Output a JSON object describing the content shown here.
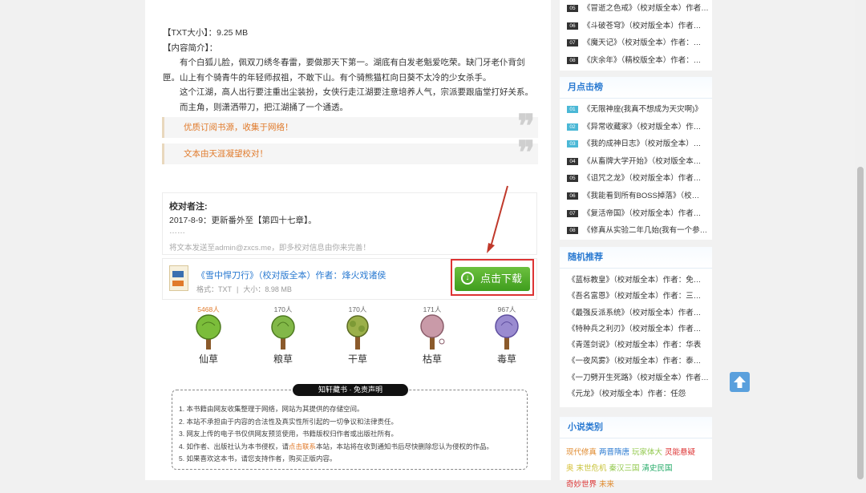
{
  "book": {
    "txt_size_line": "【TXT大小】：9.25 MB",
    "intro_heading": "【内容简介】：",
    "intro": [
      "有个白狐儿脸，佩双刀绣冬春雷，要做那天下第一。湖底有白发老魁爱吃荣。缺门牙老仆背剑匣。山上有个骑青牛的年轻师叔祖，不敢下山。有个骑熊猫杠向日葵不太冷的少女杀手。",
      "这个江湖，高人出行要注重出尘装扮，女侠行走江湖要注意培养人气，宗派要跟庙堂打好关系。",
      "而主角，则潇洒带刀，把江湖捅了一个通透。"
    ]
  },
  "quotes": [
    "优质订阅书源，收集于网络！",
    "文本由天涯凝望校对！"
  ],
  "proof_note": {
    "title": "校对者注:",
    "line": "2017-8-9：更新番外至【第四十七章】。",
    "dots": "……",
    "tip": "将文本发送至admin@zxcs.me，即多校对信息由你来完善！"
  },
  "download": {
    "link_text": "《雪中悍刀行》（校对版全本）作者：烽火戏诸侯",
    "format_label": "格式：TXT",
    "size_label": "大小：8.98 MB",
    "button_label": "点击下载",
    "button_icon": "download-arrow-icon"
  },
  "votes": [
    {
      "label": "仙草",
      "count": "5468人",
      "hot": true,
      "color": "#7bbd3a"
    },
    {
      "label": "粮草",
      "count": "170人",
      "hot": false,
      "color": "#82b848"
    },
    {
      "label": "干草",
      "count": "170人",
      "hot": false,
      "color": "#9bb04a"
    },
    {
      "label": "枯草",
      "count": "171人",
      "hot": false,
      "color": "#c99aa8"
    },
    {
      "label": "毒草",
      "count": "967人",
      "hot": false,
      "color": "#9a8bd0"
    }
  ],
  "notice": {
    "tag": "知轩藏书 · 免责声明",
    "items": [
      {
        "text": "1.  本书籍由网友收集整理于网络，网站为其提供的存储空间。"
      },
      {
        "text": "2.  本站不承担由于内容的合法性及真实性所引起的一切争议和法律责任。"
      },
      {
        "text": "3.  网友上传的电子书仅供网友预览使用，书籍版权归作者或出版社所有。"
      },
      {
        "pre": "4.  如作者、出版社认为本书侵权，请",
        "hl": "点击联系",
        "post": "本站，本站将在收到通知书后尽快删除您认为侵权的作品。"
      },
      {
        "text": "5.  如果喜欢这本书，请您支持作者，购买正版内容。"
      }
    ]
  },
  "sidebar": {
    "top_list": [
      {
        "rank": "05",
        "text": "《冒逝之色戒》（校对版全本）作者…"
      },
      {
        "rank": "06",
        "text": "《斗破苍穹》（校对版全本）作者…"
      },
      {
        "rank": "07",
        "text": "《魔天记》（校对版全本）作者：…"
      },
      {
        "rank": "08",
        "text": "《庆余年》（精校版全本）作者：…"
      }
    ],
    "monthly": {
      "title": "月点击榜",
      "items": [
        {
          "rank": "01",
          "text": "《无限神座(我真不想成为天灾啊)》"
        },
        {
          "rank": "02",
          "text": "《异常收藏家》（校对版全本）作…"
        },
        {
          "rank": "03",
          "text": "《我的成神日志》（校对版全本）…"
        },
        {
          "rank": "04",
          "text": "《从畜牌大学开始》（校对版全本…"
        },
        {
          "rank": "05",
          "text": "《诅咒之龙》（校对版全本）作者…"
        },
        {
          "rank": "06",
          "text": "《我能看到所有BOSS掉落》（校…"
        },
        {
          "rank": "07",
          "text": "《复活帝国》（校对版全本）作者…"
        },
        {
          "rank": "08",
          "text": "《修真从实验二年几始(我有一个参…"
        }
      ]
    },
    "random": {
      "title": "随机推荐",
      "items": [
        "《蓝标教皇》（校对版全本）作者：免…",
        "《吾名富恩》（校对版全本）作者：三…",
        "《最强反派系统》（校对版全本）作者…",
        "《特种兵之利刃》（校对版全本）作者…",
        "《青莲剑说》（校对版全本）作者：华表",
        "《一夜风雾》（校对版全本）作者：泰…",
        "《一刀劈开生死路》（校对版全本）作者…",
        "《元龙》（校对版全本）作者：任怨"
      ]
    },
    "categories": {
      "title": "小说类别",
      "tags": [
        {
          "text": "现代修真",
          "color": "#e08b2f"
        },
        {
          "text": "两晋隋唐",
          "color": "#2a7ad1"
        },
        {
          "text": "玩家体大",
          "color": "#93c94f"
        },
        {
          "text": "灵能悬疑",
          "color": "#d33"
        },
        {
          "text": "奥",
          "color": "#d8c23b"
        },
        {
          "text": "末世危机",
          "color": "#c8c33b"
        },
        {
          "text": "秦汉三国",
          "color": "#93c94f"
        },
        {
          "text": "清史民国",
          "color": "#2a6"
        },
        {
          "text": "奇妙世界",
          "color": "#d33"
        },
        {
          "text": "未来",
          "color": "#e08b2f"
        }
      ]
    }
  },
  "ui": {
    "back_to_top_icon": "arrow-up-icon"
  }
}
